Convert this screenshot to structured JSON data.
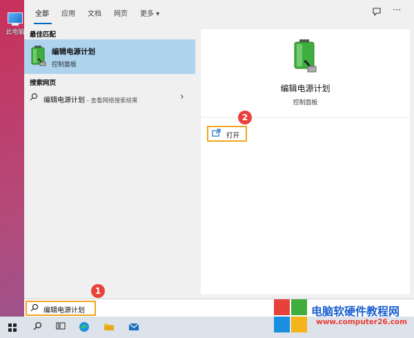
{
  "desktop": {
    "icon_label": "此电脑"
  },
  "tabs": [
    {
      "label": "全部"
    },
    {
      "label": "应用"
    },
    {
      "label": "文档"
    },
    {
      "label": "网页"
    },
    {
      "label": "更多 ▾"
    }
  ],
  "toolbar": {
    "feedback_icon": "feedback-icon",
    "more_icon": "···"
  },
  "best_match": {
    "header": "最佳匹配",
    "title": "编辑电源计划",
    "subtitle": "控制面板"
  },
  "web_search": {
    "header": "搜索网页",
    "query": "编辑电源计划",
    "suffix": " - 查看网络搜索结果"
  },
  "detail": {
    "title": "编辑电源计划",
    "subtitle": "控制面板",
    "open_label": "打开"
  },
  "search": {
    "value": "编辑电源计划"
  },
  "badges": {
    "step1": "1",
    "step2": "2"
  },
  "watermark": {
    "name": "电脑软硬件教程网",
    "url": "www.computer26.com"
  },
  "colors": {
    "accent": "#0067c0",
    "highlight": "#f1a520",
    "badge": "#e8403a",
    "selection": "#aed3ef"
  }
}
